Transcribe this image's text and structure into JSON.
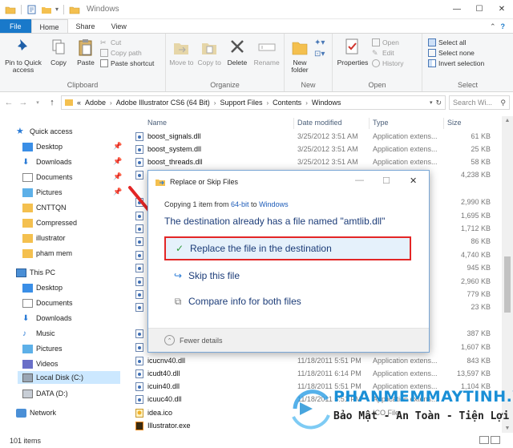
{
  "window": {
    "title": "Windows",
    "controls": [
      "—",
      "☐",
      "✕"
    ]
  },
  "ribbon_tabs": [
    {
      "label": "File"
    },
    {
      "label": "Home"
    },
    {
      "label": "Share"
    },
    {
      "label": "View"
    }
  ],
  "ribbon": {
    "clipboard": {
      "label": "Clipboard",
      "pin": "Pin to Quick access",
      "copy": "Copy",
      "paste": "Paste",
      "cut": "Cut",
      "copy_path": "Copy path",
      "paste_shortcut": "Paste shortcut"
    },
    "organize": {
      "label": "Organize",
      "move_to": "Move to",
      "copy_to": "Copy to",
      "delete": "Delete",
      "rename": "Rename"
    },
    "new": {
      "label": "New",
      "new_folder": "New folder"
    },
    "open": {
      "label": "Open",
      "properties": "Properties",
      "open": "Open",
      "edit": "Edit",
      "history": "History"
    },
    "select": {
      "label": "Select",
      "select_all": "Select all",
      "select_none": "Select none",
      "invert_selection": "Invert selection"
    }
  },
  "address": {
    "breadcrumb": [
      "«",
      "Adobe",
      "Adobe Illustrator CS6 (64 Bit)",
      "Support Files",
      "Contents",
      "Windows"
    ],
    "search_placeholder": "Search Wi..."
  },
  "nav": {
    "quick_access": "Quick access",
    "quick_items": [
      "Desktop",
      "Downloads",
      "Documents",
      "Pictures",
      "CNTTQN",
      "Compressed",
      "illustrator",
      "pham mem"
    ],
    "this_pc": "This PC",
    "pc_items": [
      "Desktop",
      "Documents",
      "Downloads",
      "Music",
      "Pictures",
      "Videos",
      "Local Disk (C:)",
      "DATA (D:)"
    ],
    "network": "Network"
  },
  "columns": {
    "name": "Name",
    "date": "Date modified",
    "type": "Type",
    "size": "Size"
  },
  "files_top": [
    {
      "name": "boost_signals.dll",
      "date": "3/25/2012 3:51 AM",
      "type": "Application extens...",
      "size": "61 KB"
    },
    {
      "name": "boost_system.dll",
      "date": "3/25/2012 3:51 AM",
      "type": "Application extens...",
      "size": "25 KB"
    },
    {
      "name": "boost_threads.dll",
      "date": "3/25/2012 3:51 AM",
      "type": "Application extens...",
      "size": "58 KB"
    }
  ],
  "files_hidden_sizes": [
    "4,238 KB",
    "2,990 KB",
    "1,695 KB",
    "1,712 KB",
    "86 KB",
    "4,740 KB",
    "945 KB",
    "2,960 KB",
    "779 KB",
    "23 KB",
    "387 KB",
    "1,607 KB"
  ],
  "files_bottom": [
    {
      "name": "icucnv40.dll",
      "date": "11/18/2011 5:51 PM",
      "type": "Application extens...",
      "size": "843 KB"
    },
    {
      "name": "icudt40.dll",
      "date": "11/18/2011 6:14 PM",
      "type": "Application extens...",
      "size": "13,597 KB"
    },
    {
      "name": "icuin40.dll",
      "date": "11/18/2011 5:51 PM",
      "type": "Application extens...",
      "size": "1,104 KB"
    },
    {
      "name": "icuuc40.dll",
      "date": "11/18/2011 5:51 PM",
      "type": "Application extens...",
      "size": ""
    },
    {
      "name": "idea.ico",
      "date": "",
      "type": "ICO File",
      "size": ""
    },
    {
      "name": "Illustrator.exe",
      "date": "",
      "type": "",
      "size": ""
    }
  ],
  "status": {
    "items": "101 items"
  },
  "dialog": {
    "title": "Replace or Skip Files",
    "copying_prefix": "Copying 1 item from ",
    "copying_from": "64-bit",
    "copying_mid": " to ",
    "copying_to": "Windows",
    "heading": "The destination already has a file named \"amtlib.dll\"",
    "option_replace": "Replace the file in the destination",
    "option_skip": "Skip this file",
    "option_compare": "Compare info for both files",
    "fewer_details": "Fewer details",
    "close": "✕",
    "restore": "☐",
    "minimize": "—"
  },
  "watermark": {
    "title": "PHANMEMMAYTINH.VN",
    "subtitle": "Bảo Mật - An Toàn - Tiện Lợi"
  },
  "colors": {
    "accent": "#1979ca",
    "highlight_border": "#e32626",
    "selection": "#cce8ff",
    "link": "#1c5bb8"
  }
}
